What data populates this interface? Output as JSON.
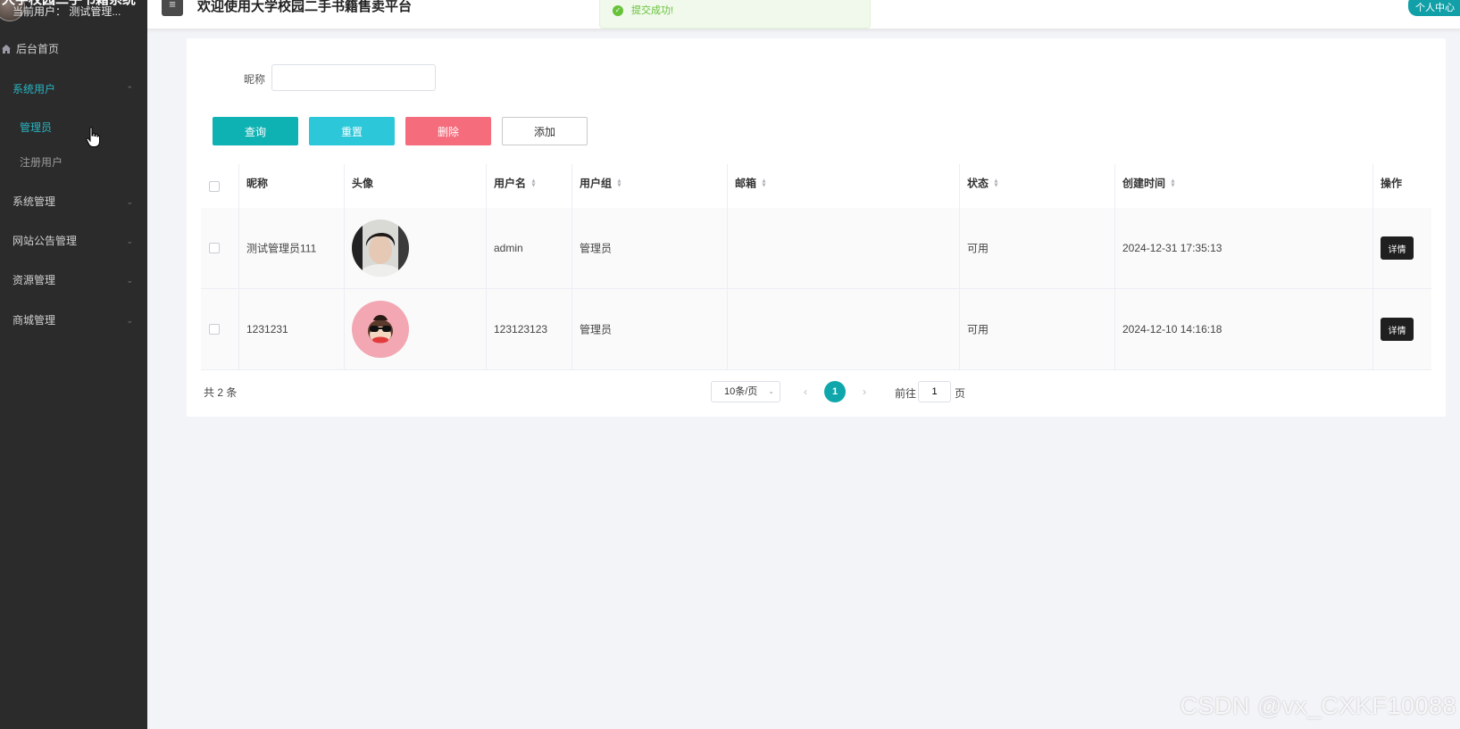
{
  "sidebar": {
    "app_title": "大学校园二手书籍系统",
    "current_user": "当前用户：  测试管理...",
    "home_label": "后台首页",
    "menu": [
      {
        "label": "系统用户"
      },
      {
        "label": "管理员"
      },
      {
        "label": "注册用户"
      },
      {
        "label": "系统管理"
      },
      {
        "label": "网站公告管理"
      },
      {
        "label": "资源管理"
      },
      {
        "label": "商城管理"
      }
    ],
    "chevron_up": "⌃",
    "chevron_down": "⌄"
  },
  "header": {
    "title": "欢迎使用大学校园二手书籍售卖平台",
    "profile": "个人中心"
  },
  "toast": {
    "message": "提交成功!"
  },
  "search": {
    "label": "昵称",
    "value": ""
  },
  "buttons": {
    "query": "查询",
    "reset": "重置",
    "delete": "删除",
    "add": "添加"
  },
  "table": {
    "columns": [
      "昵称",
      "头像",
      "用户名",
      "用户组",
      "邮箱",
      "状态",
      "创建时间",
      "操作"
    ],
    "rows": [
      {
        "nickname": "测试管理员111",
        "username": "admin",
        "group": "管理员",
        "email": "",
        "status": "可用",
        "created": "2024-12-31 17:35:13",
        "action": "详情"
      },
      {
        "nickname": "1231231",
        "username": "123123123",
        "group": "管理员",
        "email": "",
        "status": "可用",
        "created": "2024-12-10 14:16:18",
        "action": "详情"
      }
    ]
  },
  "pagination": {
    "total": "共 2 条",
    "page_size": "10条/页",
    "current_page": "1",
    "goto_prefix": "前往",
    "goto_value": "1",
    "goto_suffix": "页",
    "prev": "‹",
    "next": "›"
  },
  "watermark": "CSDN @vx_CXKF10088",
  "colors": {
    "sidebar_bg": "#2b2b2b",
    "accent": "#0fb2b3",
    "reset": "#2cc7d9",
    "delete": "#f56c7c",
    "success": "#67c23a"
  }
}
